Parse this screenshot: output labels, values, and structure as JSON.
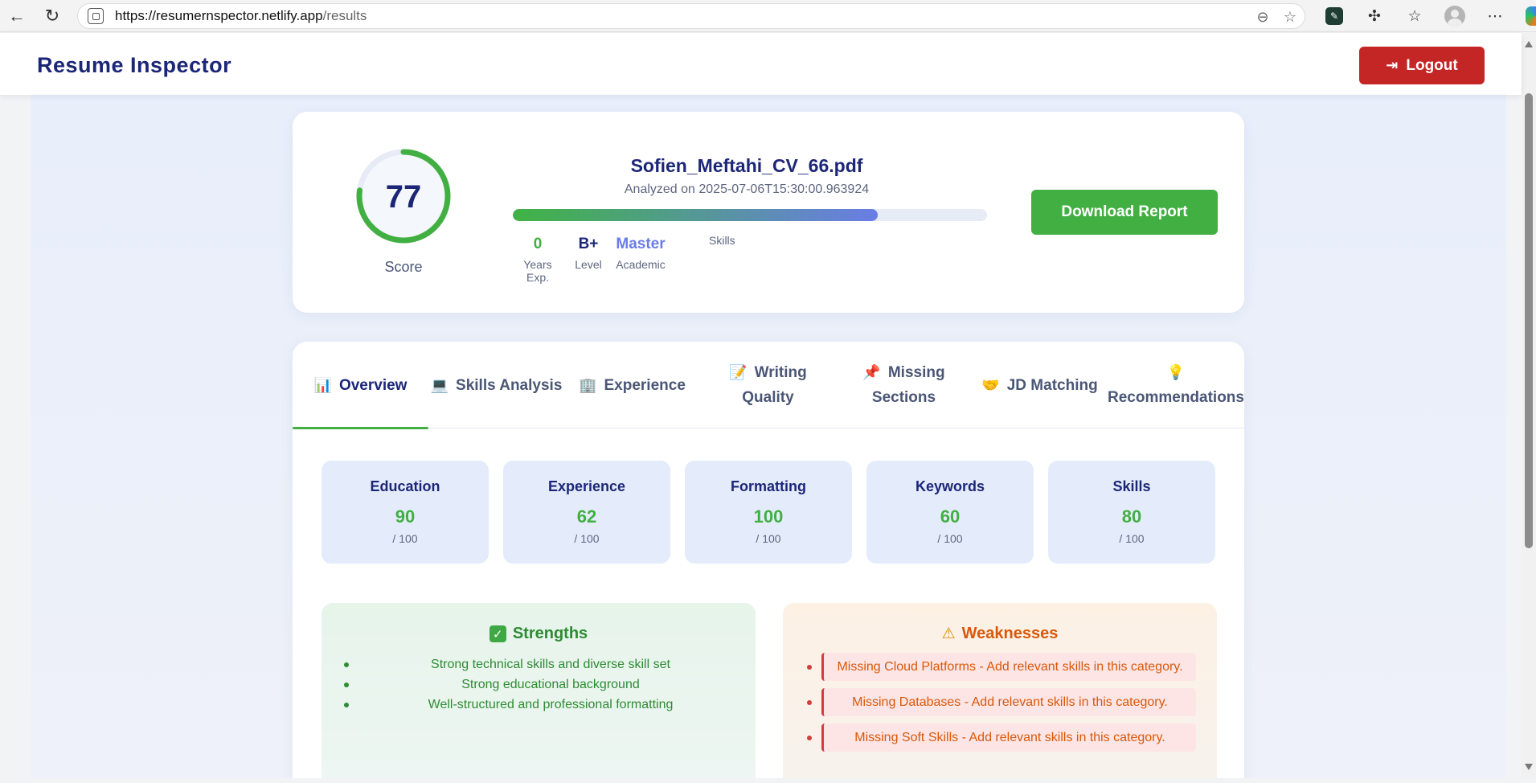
{
  "browser": {
    "url_host": "https://resumernspector.netlify.app",
    "url_path": "/results"
  },
  "app": {
    "brand": "Resume Inspector",
    "logout_label": "Logout"
  },
  "summary": {
    "score": "77",
    "score_fraction": 0.77,
    "score_label": "Score",
    "file_name": "Sofien_Meftahi_CV_66.pdf",
    "analyzed": "Analyzed on 2025-07-06T15:30:00.963924",
    "progress_fraction": 0.77,
    "stats": [
      {
        "value": "0",
        "label": "Years Exp.",
        "color": "#42af42"
      },
      {
        "value": "B+",
        "label": "Level",
        "color": "#1c2677"
      },
      {
        "value": "Master",
        "label": "Academic",
        "color": "#6a7de6"
      }
    ],
    "skills_label": "Skills",
    "download_label": "Download Report"
  },
  "tabs": [
    {
      "icon": "📊",
      "label": "Overview"
    },
    {
      "icon": "💻",
      "label": "Skills Analysis"
    },
    {
      "icon": "🏢",
      "label": "Experience"
    },
    {
      "icon": "📝",
      "label": "Writing",
      "label2": "Quality"
    },
    {
      "icon": "📌",
      "label": "Missing",
      "label2": "Sections"
    },
    {
      "icon": "🤝",
      "label": "JD Matching"
    },
    {
      "icon": "💡",
      "label": "Recommendations"
    }
  ],
  "metrics": [
    {
      "name": "Education",
      "value": "90",
      "max": "/ 100"
    },
    {
      "name": "Experience",
      "value": "62",
      "max": "/ 100"
    },
    {
      "name": "Formatting",
      "value": "100",
      "max": "/ 100"
    },
    {
      "name": "Keywords",
      "value": "60",
      "max": "/ 100"
    },
    {
      "name": "Skills",
      "value": "80",
      "max": "/ 100"
    }
  ],
  "strengths": {
    "title": "Strengths",
    "items": [
      "Strong technical skills and diverse skill set",
      "Strong educational background",
      "Well-structured and professional formatting"
    ]
  },
  "weaknesses": {
    "title": "Weaknesses",
    "items": [
      "Missing Cloud Platforms - Add relevant skills in this category.",
      "Missing Databases - Add relevant skills in this category.",
      "Missing Soft Skills - Add relevant skills in this category."
    ]
  },
  "colors": {
    "accent_green": "#42af42",
    "brand_navy": "#1c2677",
    "logout_red": "#c42626",
    "warning_orange": "#d9580a"
  }
}
